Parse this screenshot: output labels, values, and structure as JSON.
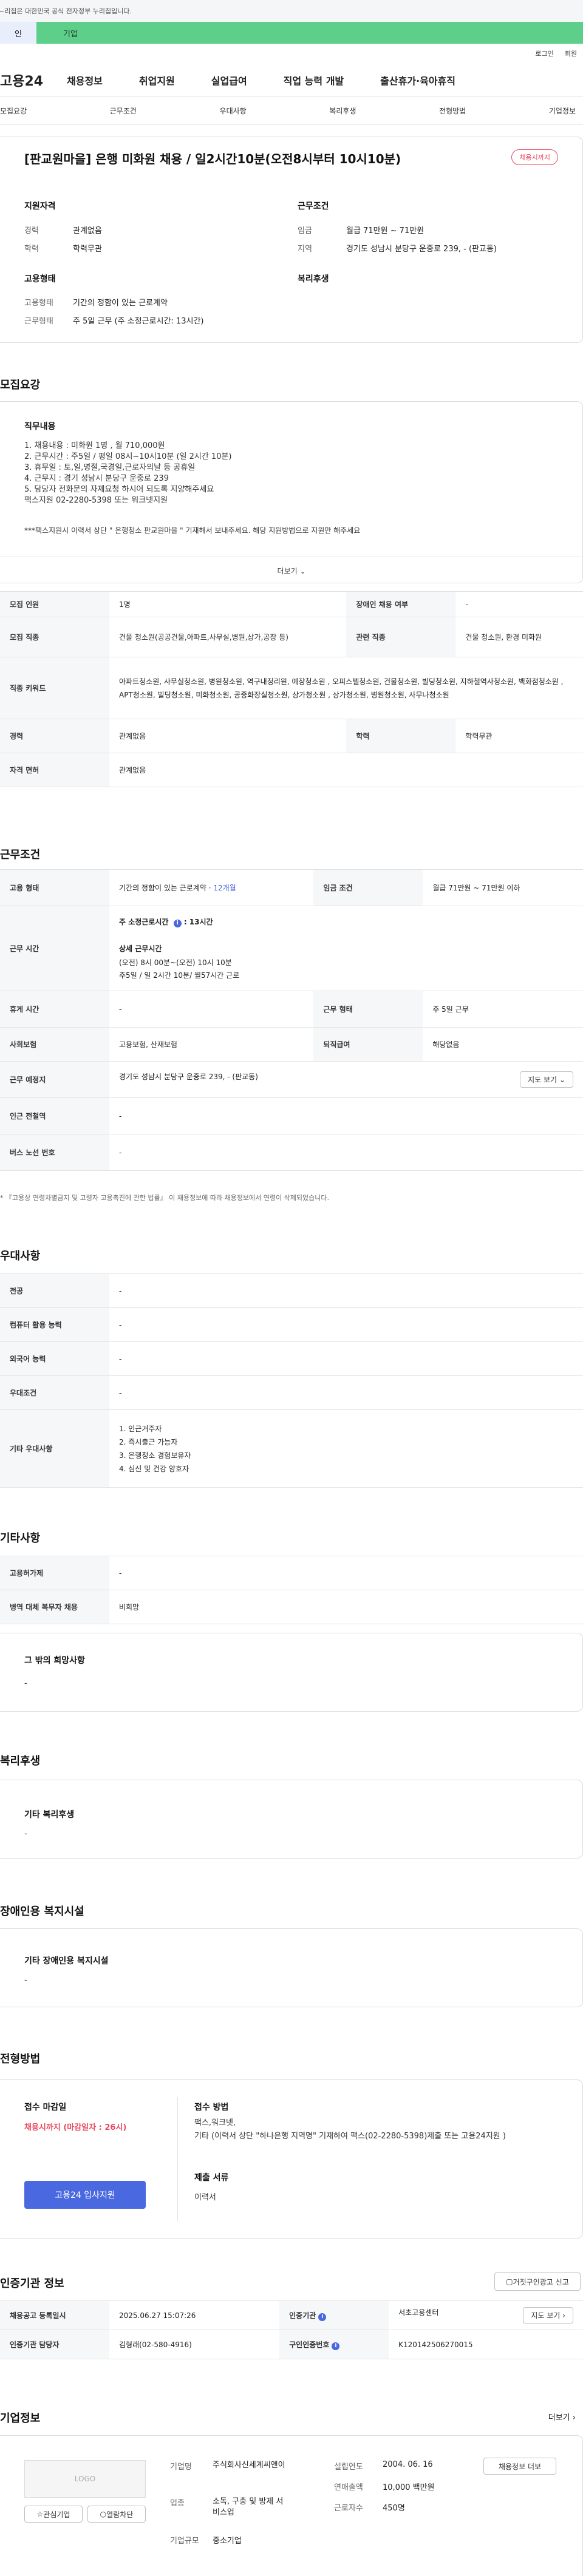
{
  "topbar": {
    "notice": "~리집은 대한민국 공식 전자정부 누리집입니다."
  },
  "typetabs": [
    {
      "label": "인"
    },
    {
      "label": "기업"
    }
  ],
  "util": {
    "login": "로그인",
    "signup": "회원"
  },
  "gnb": {
    "logo": "고용24",
    "items": [
      "채용정보",
      "취업지원",
      "실업급여",
      "직업 능력 개발",
      "출산휴가·육아휴직"
    ]
  },
  "subnav": [
    "모집요강",
    "근무조건",
    "우대사항",
    "복리후생",
    "전형방법",
    "기업정보"
  ],
  "job": {
    "title": "[판교원마을] 은행 미화원 채용 / 일2시간10분(오전8시부터 10시10분)",
    "badge": "채용시까지",
    "qualification_h": "지원자격",
    "career_k": "경력",
    "career_v": "관계없음",
    "edu_k": "학력",
    "edu_v": "학력무관",
    "employ_h": "고용형태",
    "emptype_k": "고용형태",
    "emptype_v": "기간의 정함이 있는 근로계약",
    "worktype_k": "근무형태",
    "worktype_v": "주 5일 근무 (주 소정근로시간: 13시간)",
    "cond_h": "근무조건",
    "wage_k": "임금",
    "wage_v": "월급 71만원 ~ 71만원",
    "region_k": "지역",
    "region_v": "경기도 성남시 분당구 운중로 239, - (판교동)",
    "welfare_h": "복리후생"
  },
  "recruit": {
    "h": "모집요강",
    "duty_h": "직무내용",
    "duty_text": "1. 채용내용 : 미화원 1명 , 월 710,000원\n2. 근무시간 : 주5일 / 평일 08시~10시10분 (일 2시간 10분)\n3. 휴무일 : 토,일,명절,국경일,근로자의날 등 공휴일\n4. 근무지 : 경기 성남시 분당구 운중로 239\n5. 담당자 전화문의 자제요청 하시어 되도록 지양해주세요\n    팩스지원 02-2280-5398 또는 워크넷지원",
    "duty_note": "***팩스지원시 이력서 상단 \" 은행청소 판교원마을 \" 기재해서 보내주세요. 해당 지원방법으로 지원만 해주세요",
    "more": "더보기",
    "rows": {
      "count_k": "모집 인원",
      "count_v": "1명",
      "disabled_k": "장애인 채용 여부",
      "disabled_v": "-",
      "job_k": "모집 직종",
      "job_v": "건물 청소원(공공건물,아파트,사무실,병원,상가,공장 등)",
      "related_k": "관련 직종",
      "related_v": "건물 청소원, 환경 미화원",
      "kw_k": "직종 키워드",
      "kw_v": "아파트청소원, 사무실청소원, 병원청소원, 역구내정리원, 예장청소원 , 오피스텔청소원, 건물청소원, 빌딩청소원, 지하철역사청소원, 백화점청소원 , APT청소원, 빌딩청소원, 미화청소원, 공중화장실청소원, 상가청소원 , 상가청소원, 병원청소원, 사무나청소원",
      "career_k": "경력",
      "career_v": "관계없음",
      "edu_k": "학력",
      "edu_v": "학력무관",
      "license_k": "자격 면허",
      "license_v": "관계없음"
    }
  },
  "work": {
    "h": "근무조건",
    "emptype_k": "고용 형태",
    "emptype_v": "기간의 정함이 있는 근로계약 · ",
    "emptype_months": "12개월",
    "wage_k": "임금 조건",
    "wage_v": "월급 71만원 ~ 71만원 이하",
    "hours_k": "근무 시간",
    "hours_week": "주 소정근로시간 ",
    "hours_week_v": "13시간",
    "hours_detail_h": "상세 근무시간",
    "hours_detail_1": "(오전) 8시 00분~(오전) 10시 10분",
    "hours_detail_2": " 주5일 / 일 2시간 10분/ 월57시간 근로",
    "break_k": "휴게 시간",
    "break_v": "-",
    "form_k": "근무 형태",
    "form_v": "주 5일 근무",
    "insur_k": "사회보험",
    "insur_v": "고용보험, 산재보험",
    "retire_k": "퇴직급여",
    "retire_v": "해당없음",
    "place_k": "근무 예정지",
    "place_v": "경기도 성남시 분당구 운중로 239, - (판교동)",
    "map_btn": "지도 보기",
    "subway_k": "인근 전철역",
    "subway_v": "-",
    "bus_k": "버스 노선 번호",
    "bus_v": "-",
    "note": "* 『고용상 연령차별금지 및 고령자 고용촉진에 관한 법률』 이 채용정보에 따라 채용정보에서 연령이 삭제되었습니다."
  },
  "pref": {
    "h": "우대사항",
    "major_k": "전공",
    "major_v": "-",
    "pc_k": "컴퓨터 활용 능력",
    "pc_v": "-",
    "lang_k": "외국어 능력",
    "lang_v": "-",
    "cond_k": "우대조건",
    "cond_v": "-",
    "other_k": "기타 우대사항",
    "other_list": [
      "1. 인근거주자",
      "2. 즉시출근 가능자",
      "3. 은행청소 경험보유자",
      "4. 심신 및 건강 양호자"
    ]
  },
  "etc": {
    "h": "기타사항",
    "hire_k": "고용허가제",
    "hire_v": "-",
    "military_k": "병역 대체 복무자 채용",
    "military_v": "비희망",
    "wish_h": "그 밖의 희망사항",
    "wish_v": "-"
  },
  "welfare": {
    "h": "복리후생",
    "sub": "기타 복리후생",
    "v": "-"
  },
  "facility": {
    "h": "장애인용 복지시설",
    "sub": "기타 장애인용 복지시설",
    "v": "-"
  },
  "process": {
    "h": "전형방법",
    "deadline_h": "접수 마감일",
    "deadline_v": "채용시까지 (마감일자 : 26시)",
    "apply_btn": "고용24 입사지원",
    "method_h": "접수 방법",
    "method_v1": "팩스,워크넷,",
    "method_v2": "기타 (이력서 상단 \"하나은행 지역명\" 기재하여 팩스(02-2280-5398)제출 또는 고용24지원 )",
    "docs_h": "제출 서류",
    "docs_v": "이력서"
  },
  "cert": {
    "h": "인증기관 정보",
    "report_btn": "거짓구인광고 신고",
    "reg_k": "채용공고 등록일시",
    "reg_v": "2025.06.27 15:07:26",
    "org_k": "인증기관",
    "org_v": "서초고용센터",
    "map_btn": "지도 보기",
    "mgr_k": "인증기관 담당자",
    "mgr_v": "김형래(02-580-4916)",
    "num_k": "구인인증번호",
    "num_v": "K120142506270015"
  },
  "company": {
    "h": "기업정보",
    "more": "더보기",
    "logo": "LOGO",
    "fav_btn": "관심기업",
    "block_btn": "열람차단",
    "type_k": "기업명",
    "type_v": "주식회사신세계씨앤이",
    "industry_k": "업종",
    "industry_v": "소독, 구충 및 방제 서비스업",
    "scale_k": "기업규모",
    "scale_v": "중소기업",
    "est_k": "설립연도",
    "est_v": "2004. 06. 16",
    "sales_k": "연매출액",
    "sales_v": "10,000 백만원",
    "emp_k": "근로자수",
    "emp_v": "450명",
    "jobs_btn": "채용정보 더보"
  }
}
